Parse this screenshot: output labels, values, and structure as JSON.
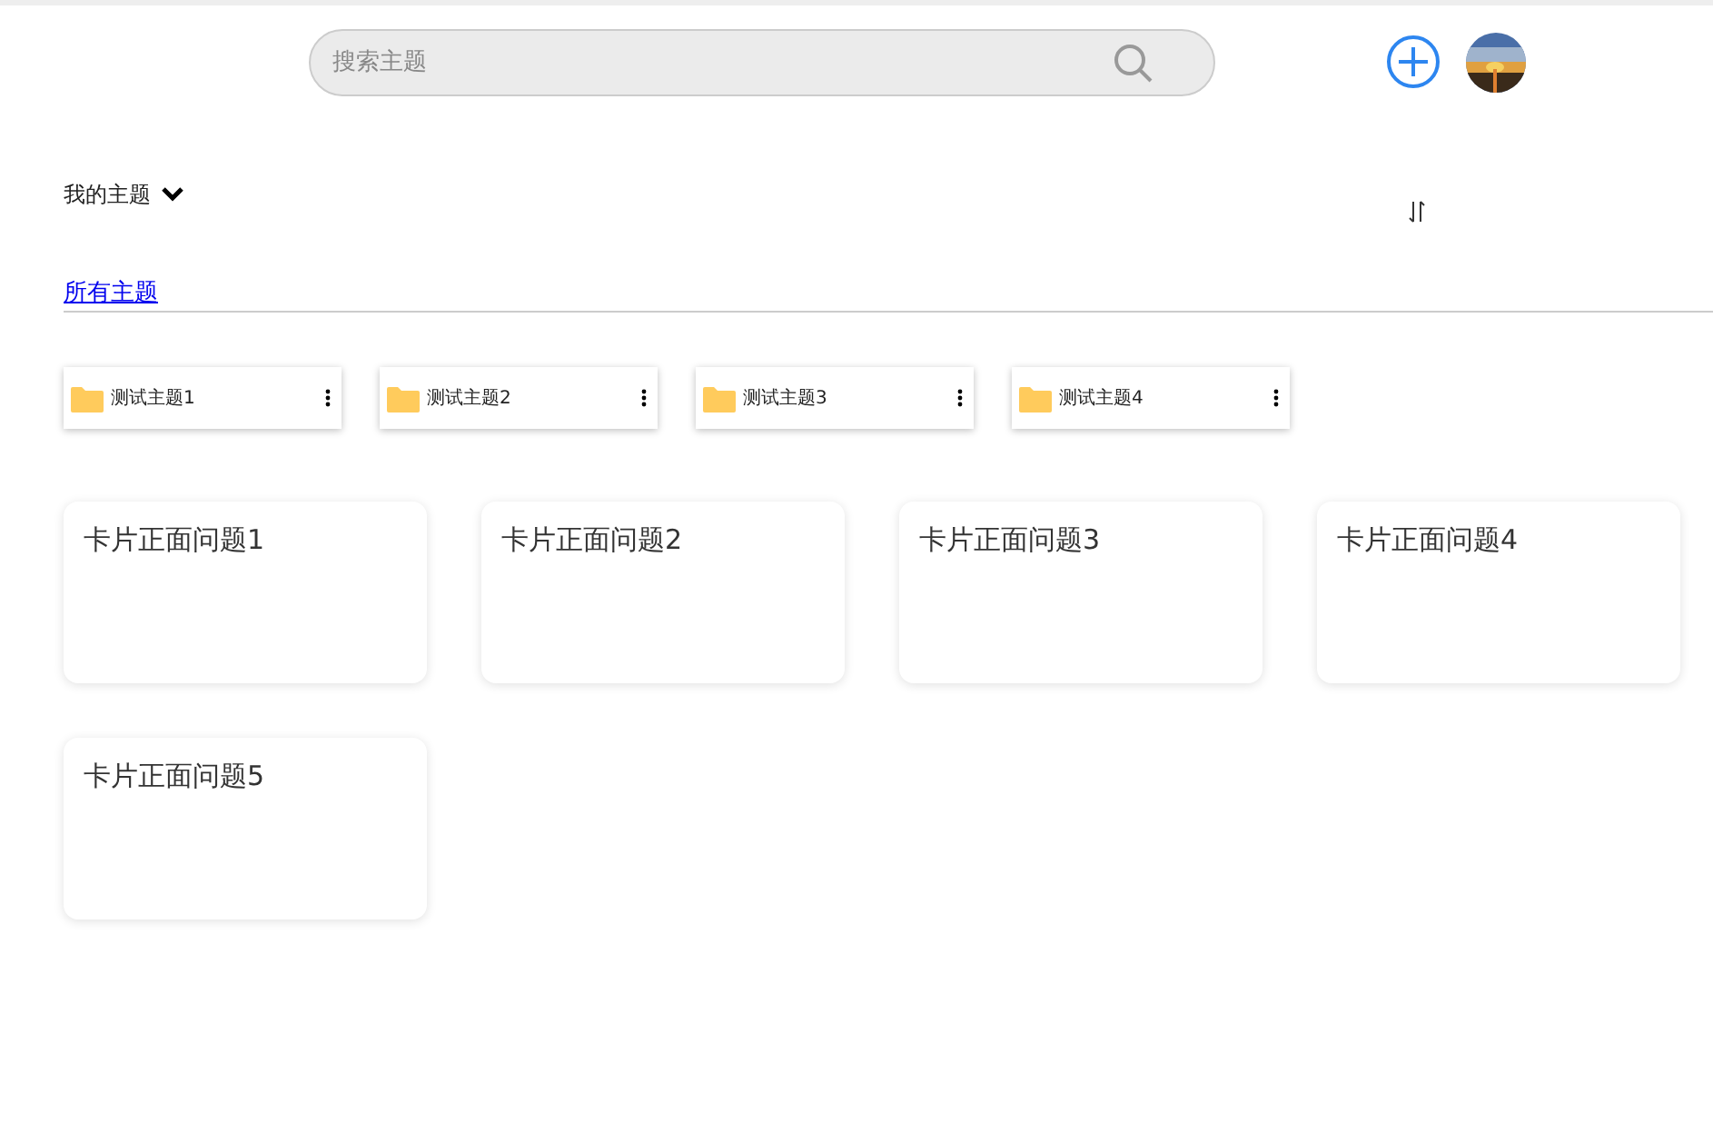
{
  "search": {
    "placeholder": "搜索主题"
  },
  "section": {
    "title": "我的主题",
    "expanded": true
  },
  "link": "所有主题",
  "folders": [
    {
      "name": "测试主题1"
    },
    {
      "name": "测试主题2"
    },
    {
      "name": "测试主题3"
    },
    {
      "name": "测试主题4"
    }
  ],
  "cards": [
    {
      "question": "卡片正面问题1"
    },
    {
      "question": "卡片正面问题2"
    },
    {
      "question": "卡片正面问题3"
    },
    {
      "question": "卡片正面问题4"
    },
    {
      "question": "卡片正面问题5"
    }
  ]
}
